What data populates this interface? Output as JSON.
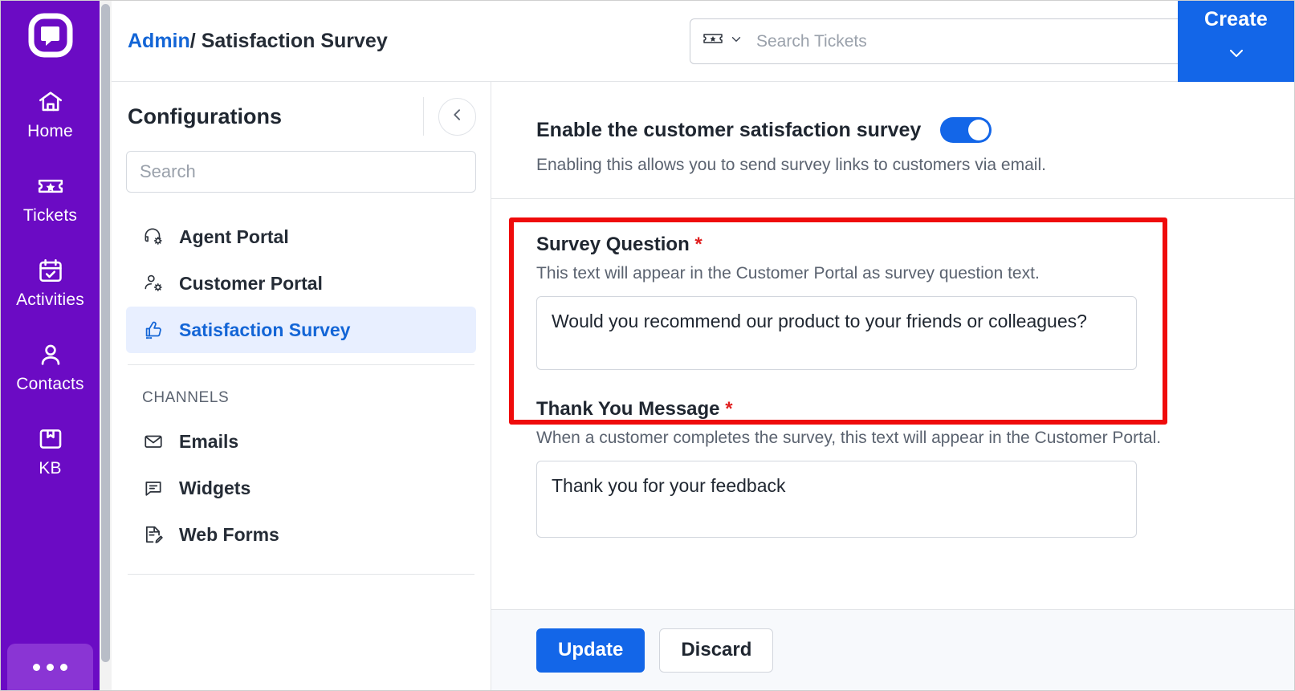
{
  "rail": {
    "logo_icon": "chat-bubble-square-logo",
    "items": [
      {
        "label": "Home",
        "icon": "home-icon"
      },
      {
        "label": "Tickets",
        "icon": "ticket-star-icon"
      },
      {
        "label": "Activities",
        "icon": "calendar-check-icon"
      },
      {
        "label": "Contacts",
        "icon": "person-icon"
      },
      {
        "label": "KB",
        "icon": "book-bookmark-icon"
      }
    ],
    "more_icon": "more-horizontal-icon",
    "background_color": "#6B0BC4",
    "more_background_color": "#8A35D4"
  },
  "topbar": {
    "breadcrumb_root": "Admin",
    "breadcrumb_separator": "/",
    "breadcrumb_current": "Satisfaction Survey",
    "search": {
      "type_icon": "ticket-star-icon",
      "type_chevron_icon": "chevron-down-icon",
      "placeholder": "Search Tickets",
      "value": "",
      "filter_icon": "filter-funnel-icon"
    },
    "create": {
      "label": "Create",
      "chevron_icon": "chevron-down-icon",
      "color": "#1366E8"
    }
  },
  "configurations": {
    "title": "Configurations",
    "collapse_icon": "chevron-left-icon",
    "search_placeholder": "Search",
    "search_value": "",
    "items": [
      {
        "label": "Agent Portal",
        "icon": "headset-gear-icon",
        "active": false
      },
      {
        "label": "Customer Portal",
        "icon": "person-gear-icon",
        "active": false
      },
      {
        "label": "Satisfaction Survey",
        "icon": "thumbs-up-icon",
        "active": true
      }
    ],
    "group_label": "CHANNELS",
    "channels": [
      {
        "label": "Emails",
        "icon": "envelope-icon"
      },
      {
        "label": "Widgets",
        "icon": "chat-widget-icon"
      },
      {
        "label": "Web Forms",
        "icon": "form-edit-icon"
      }
    ],
    "active_color": "#1365D6",
    "active_background": "#E8EFFF"
  },
  "main": {
    "enable_toggle": {
      "label": "Enable the customer satisfaction survey",
      "help": "Enabling this allows you to send survey links to customers via email.",
      "checked": true,
      "on_color": "#1366E8"
    },
    "survey_question": {
      "label": "Survey Question",
      "required_mark": "*",
      "help": "This text will appear in the Customer Portal as survey question text.",
      "value": "Would you recommend our product to your friends or colleagues?"
    },
    "thank_you_message": {
      "label": "Thank You Message",
      "required_mark": "*",
      "help": "When a customer completes the survey, this text will appear in the Customer Portal.",
      "value": "Thank you for your feedback"
    },
    "annotation": {
      "type": "red-highlight-rectangle",
      "color": "#EF0B0B",
      "targets": "survey-question-field"
    }
  },
  "footer": {
    "update_label": "Update",
    "discard_label": "Discard"
  }
}
